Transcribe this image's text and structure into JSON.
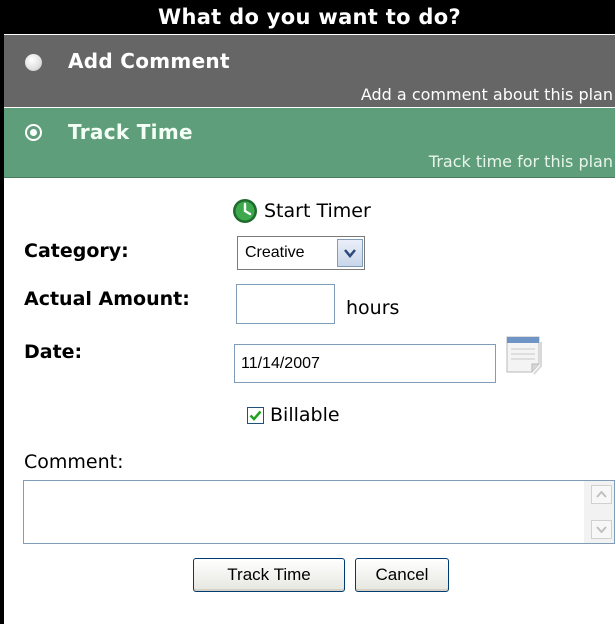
{
  "header": {
    "title": "What do you want to do?"
  },
  "options": {
    "add_comment": {
      "title": "Add Comment",
      "description": "Add a comment about this plan"
    },
    "track_time": {
      "title": "Track Time",
      "description": "Track time for this plan"
    }
  },
  "timer": {
    "label": "Start Timer"
  },
  "form": {
    "category_label": "Category:",
    "category_value": "Creative",
    "amount_label": "Actual Amount:",
    "amount_value": "",
    "amount_unit": "hours",
    "date_label": "Date:",
    "date_value": "11/14/2007",
    "billable_label": "Billable",
    "billable_checked": true,
    "comment_label": "Comment:",
    "comment_value": ""
  },
  "buttons": {
    "track": "Track Time",
    "cancel": "Cancel"
  },
  "colors": {
    "header_bg": "#000000",
    "add_bg": "#666666",
    "track_bg": "#5f9e7a"
  },
  "icons": {
    "timer": "clock-icon",
    "calendar": "calendar-icon",
    "dropdown": "chevron-down-icon"
  }
}
